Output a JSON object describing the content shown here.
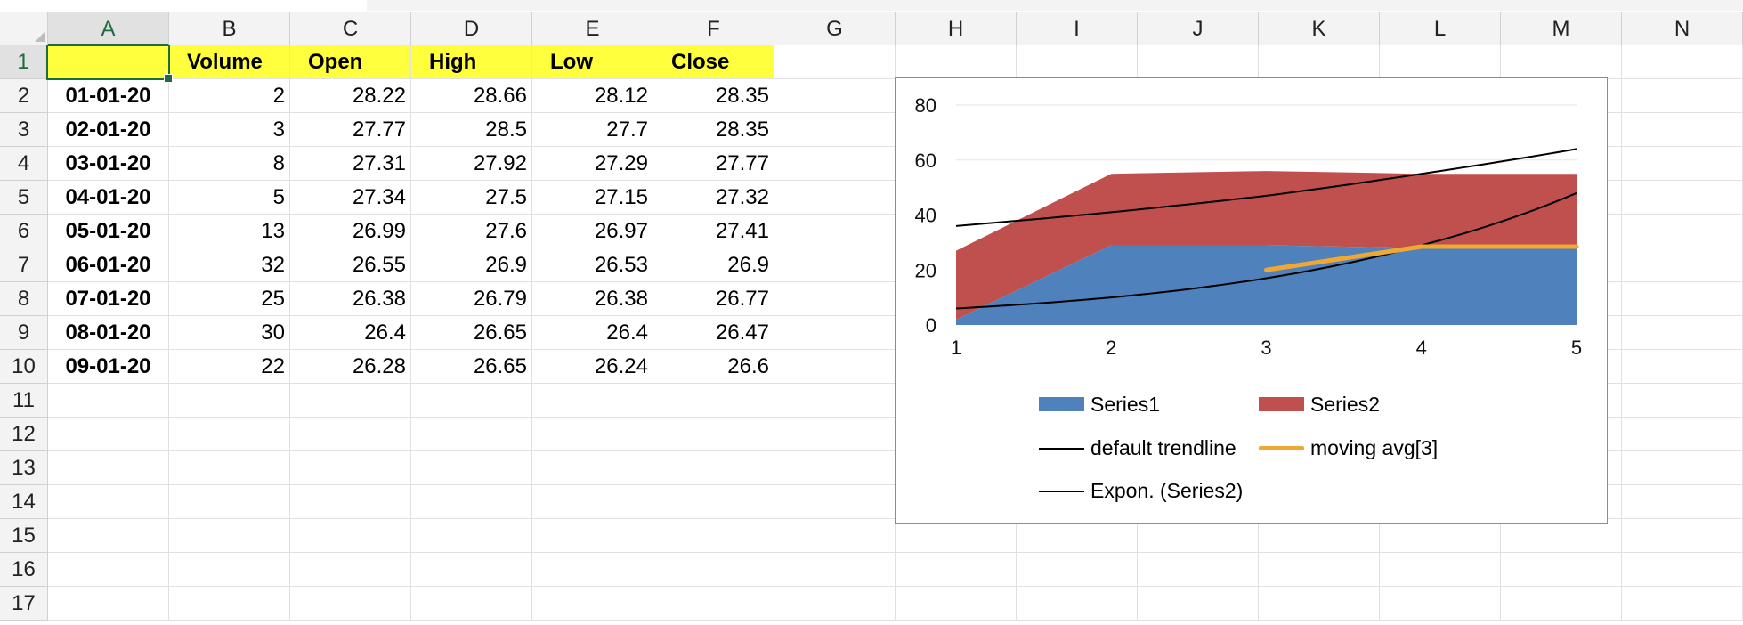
{
  "columns": [
    "A",
    "B",
    "C",
    "D",
    "E",
    "F",
    "G",
    "H",
    "I",
    "J",
    "K",
    "L",
    "M",
    "N"
  ],
  "rows": [
    "1",
    "2",
    "3",
    "4",
    "5",
    "6",
    "7",
    "8",
    "9",
    "10",
    "11",
    "12",
    "13",
    "14",
    "15",
    "16",
    "17"
  ],
  "active_cell": "A1",
  "header_row": [
    "",
    "Volume",
    "Open",
    "High",
    "Low",
    "Close"
  ],
  "data_rows": [
    [
      "01-01-20",
      "2",
      "28.22",
      "28.66",
      "28.12",
      "28.35"
    ],
    [
      "02-01-20",
      "3",
      "27.77",
      "28.5",
      "27.7",
      "28.35"
    ],
    [
      "03-01-20",
      "8",
      "27.31",
      "27.92",
      "27.29",
      "27.77"
    ],
    [
      "04-01-20",
      "5",
      "27.34",
      "27.5",
      "27.15",
      "27.32"
    ],
    [
      "05-01-20",
      "13",
      "26.99",
      "27.6",
      "26.97",
      "27.41"
    ],
    [
      "06-01-20",
      "32",
      "26.55",
      "26.9",
      "26.53",
      "26.9"
    ],
    [
      "07-01-20",
      "25",
      "26.38",
      "26.79",
      "26.38",
      "26.77"
    ],
    [
      "08-01-20",
      "30",
      "26.4",
      "26.65",
      "26.4",
      "26.47"
    ],
    [
      "09-01-20",
      "22",
      "26.28",
      "26.65",
      "26.24",
      "26.6"
    ]
  ],
  "colors": {
    "header_fill": "#ffff3d",
    "active_green": "#1e6b3d",
    "series1": "#4f81bd",
    "series2": "#c0504d",
    "moving_avg": "#f0a830",
    "trendline": "#000000"
  },
  "chart_data": {
    "type": "area",
    "x": [
      1,
      2,
      3,
      4,
      5
    ],
    "ylim": [
      0,
      80
    ],
    "yticks": [
      0,
      20,
      40,
      60,
      80
    ],
    "xticks": [
      1,
      2,
      3,
      4,
      5
    ],
    "gridlines": true,
    "legend_position": "bottom",
    "series": [
      {
        "name": "Series1",
        "kind": "stacked-area",
        "values": [
          2,
          29,
          29,
          28,
          28
        ]
      },
      {
        "name": "Series2",
        "kind": "stacked-area",
        "values": [
          25,
          26,
          27,
          27,
          27
        ]
      }
    ],
    "overlays": [
      {
        "name": "default trendline",
        "kind": "trendline",
        "values": [
          36,
          41,
          47,
          55,
          64
        ]
      },
      {
        "name": "moving avg[3]",
        "kind": "moving-average",
        "x": [
          3,
          4,
          5
        ],
        "values": [
          20,
          28.5,
          28.5
        ]
      },
      {
        "name": "Expon. (Series2)",
        "kind": "exponential-trendline",
        "values": [
          6,
          10,
          17,
          29,
          48
        ]
      }
    ],
    "legend": [
      "Series1",
      "Series2",
      "default trendline",
      "moving avg[3]",
      "Expon. (Series2)"
    ]
  }
}
